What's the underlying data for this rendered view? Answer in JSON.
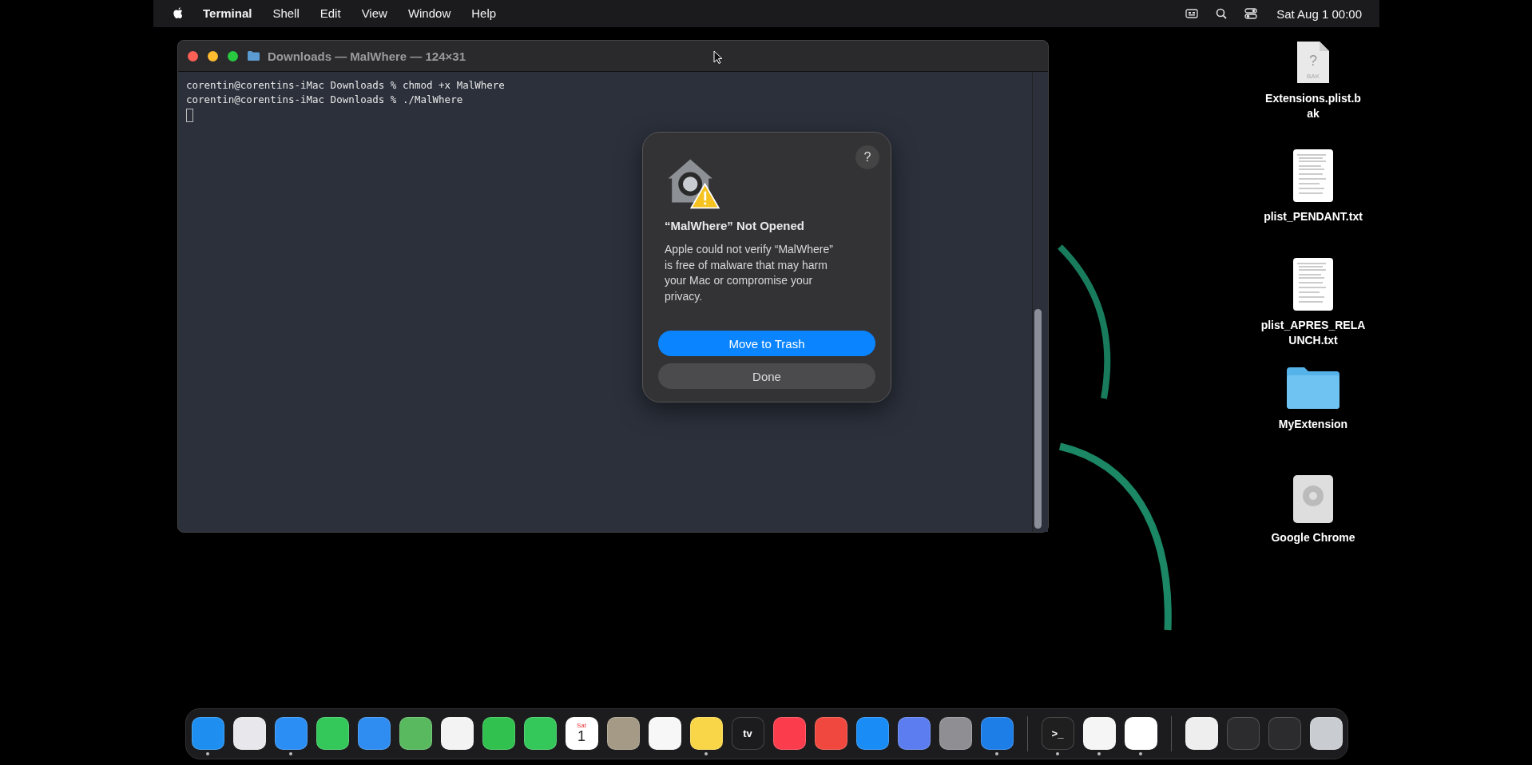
{
  "menu_bar": {
    "app_name": "Terminal",
    "menus": [
      "Shell",
      "Edit",
      "View",
      "Window",
      "Help"
    ],
    "clock": "Sat Aug 1  00:00"
  },
  "terminal": {
    "title": "Downloads — MalWhere — 124×31",
    "lines": [
      "corentin@corentins-iMac Downloads % chmod +x MalWhere",
      "corentin@corentins-iMac Downloads % ./MalWhere"
    ]
  },
  "dialog": {
    "help": "?",
    "title": "“MalWhere” Not Opened",
    "message": "Apple could not verify “MalWhere” is free of malware that may harm your Mac or compromise your privacy.",
    "buttons": [
      {
        "label": "Move to Trash",
        "kind": "primary"
      },
      {
        "label": "Done",
        "kind": "secondary"
      }
    ]
  },
  "desktop_icons": [
    {
      "kind": "unknown",
      "glyph": "?",
      "badge": "BAK",
      "name_lines": [
        "Extensions.plist.b",
        "ak"
      ]
    },
    {
      "kind": "text",
      "name_lines": [
        "plist_PENDANT.txt"
      ]
    },
    {
      "kind": "text",
      "name_lines": [
        "plist_APRES_RELA",
        "UNCH.txt"
      ]
    },
    {
      "kind": "folder",
      "name_lines": [
        "MyExtension"
      ]
    },
    {
      "kind": "app",
      "name_lines": [
        "Google Chrome"
      ]
    }
  ],
  "dock": {
    "groups": [
      [
        {
          "color": "#1e8ff0",
          "running": true
        },
        {
          "color": "#e8e8ec",
          "running": false
        },
        {
          "color": "#2a8ef5",
          "running": true
        },
        {
          "color": "#34c759",
          "running": false
        },
        {
          "color": "#2f8cf0",
          "running": false
        },
        {
          "color": "#58b95e",
          "running": false
        },
        {
          "color": "#f3f3f3",
          "running": false
        },
        {
          "color": "#30c14e",
          "running": false
        },
        {
          "color": "#34c759",
          "running": false
        },
        {
          "color": "#ffffff",
          "running": false,
          "top": "Sat",
          "text": "1"
        },
        {
          "color": "#a59a86",
          "running": false
        },
        {
          "color": "#f7f7f7",
          "running": false
        },
        {
          "color": "#f8d648",
          "running": true
        },
        {
          "color": "#1c1c1e",
          "running": false,
          "text": "tv"
        },
        {
          "color": "#fa3c4c",
          "running": false
        },
        {
          "color": "#f0483e",
          "running": false
        },
        {
          "color": "#1a8cf5",
          "running": false
        },
        {
          "color": "#5b7df0",
          "running": false
        },
        {
          "color": "#8e8e93",
          "running": false
        },
        {
          "color": "#1d7ee8",
          "running": true
        }
      ],
      [
        {
          "color": "#1f1f1f",
          "running": true,
          "text": ">_"
        },
        {
          "color": "#f5f5f5",
          "running": true
        },
        {
          "color": "#ffffff",
          "running": true
        }
      ],
      [
        {
          "color": "#eeeeee",
          "running": false
        },
        {
          "color": "#2c2c2e",
          "running": false
        },
        {
          "color": "#2c2c2e",
          "running": false
        },
        {
          "color": "#c9ccd1",
          "running": false
        }
      ]
    ]
  }
}
